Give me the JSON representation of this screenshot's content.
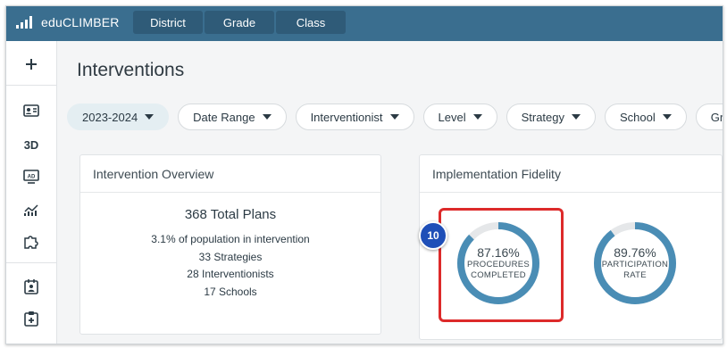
{
  "app": {
    "name": "eduCLIMBER"
  },
  "nav_tabs": [
    {
      "label": "District"
    },
    {
      "label": "Grade"
    },
    {
      "label": "Class"
    }
  ],
  "sidebar": {
    "items": [
      {
        "icon": "plus-icon"
      },
      {
        "icon": "student-card-icon"
      },
      {
        "label": "3D"
      },
      {
        "icon": "ad-screen-icon"
      },
      {
        "icon": "analytics-chart-icon"
      },
      {
        "icon": "puzzle-icon"
      },
      {
        "icon": "calendar-person-icon"
      },
      {
        "icon": "clipboard-plus-icon"
      }
    ]
  },
  "page": {
    "title": "Interventions"
  },
  "filters": [
    {
      "label": "2023-2024",
      "active": true
    },
    {
      "label": "Date Range"
    },
    {
      "label": "Interventionist"
    },
    {
      "label": "Level"
    },
    {
      "label": "Strategy"
    },
    {
      "label": "School"
    },
    {
      "label": "Grade"
    }
  ],
  "overview": {
    "title": "Intervention Overview",
    "total": "368 Total Plans",
    "lines": [
      "3.1% of population in intervention",
      "33 Strategies",
      "28 Interventionists",
      "17 Schools"
    ]
  },
  "fidelity": {
    "title": "Implementation Fidelity",
    "metrics": [
      {
        "value": "87.16%",
        "label_line1": "PROCEDURES",
        "label_line2": "COMPLETED",
        "percent": 87.16
      },
      {
        "value": "89.76%",
        "label_line1": "PARTICIPATION",
        "label_line2": "RATE",
        "percent": 89.76
      }
    ]
  },
  "annotation": {
    "step": "10"
  },
  "colors": {
    "topbar": "#3a6e8f",
    "donut": "#4a8db5",
    "donut_track": "#e5e7e9",
    "highlight": "#dd2a2a",
    "badge": "#1f4fb8"
  }
}
